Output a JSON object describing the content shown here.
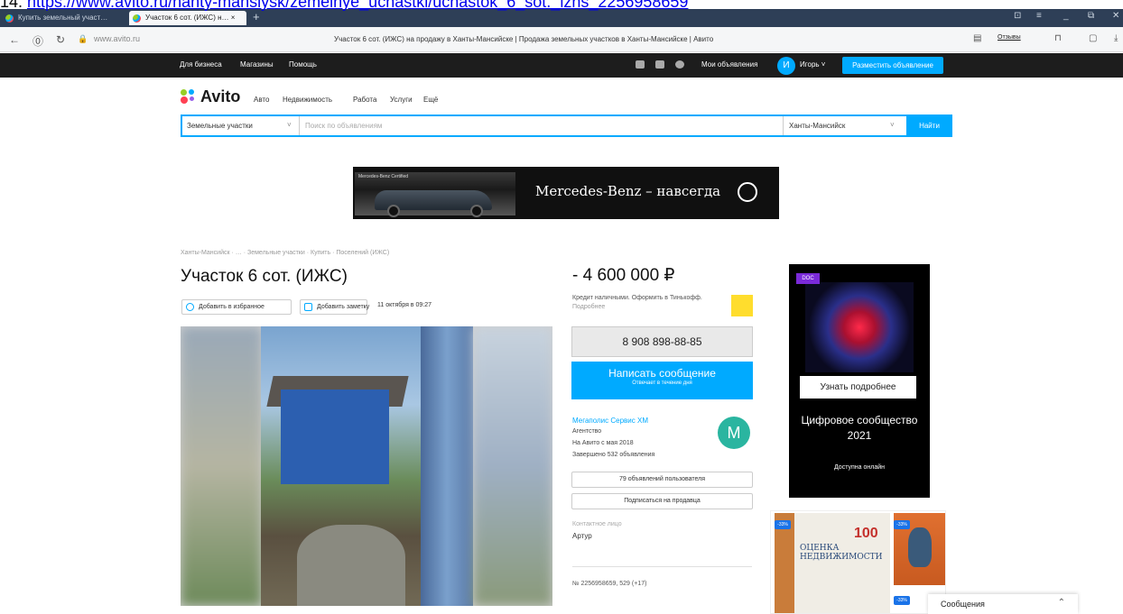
{
  "overlay_url": {
    "prefix": "14. ",
    "link": "https://www.avito.ru/hanty-mansiysk/zemelnye_uchastki/uchastok_6_sot._izhs_2256958659"
  },
  "browser": {
    "tabs": [
      {
        "label": "Купить земельный участ…"
      },
      {
        "label": "Участок 6 сот. (ИЖС) н… ×"
      }
    ],
    "new_tab": "+",
    "address": "www.avito.ru",
    "page_title": "Участок 6 сот. (ИЖС) на продажу в Ханты-Мансийске | Продажа земельных участков в Ханты-Мансийске | Авито",
    "reviews_label": "Отзывы"
  },
  "topnav": {
    "links": [
      "Для бизнеса",
      "Магазины",
      "Помощь"
    ],
    "my_ads": "Мои объявления",
    "avatar_letter": "И",
    "user": "Игорь",
    "post_button": "Разместить объявление"
  },
  "header": {
    "logo": "Avito",
    "categories": [
      "Авто",
      "Недвижимость",
      "Работа",
      "Услуги",
      "Ещё"
    ],
    "category_select": "Земельные участки",
    "search_placeholder": "Поиск по объявлениям",
    "city_select": "Ханты-Мансийск",
    "find_button": "Найти"
  },
  "banner": {
    "small_text": "Mercedes-Benz Certified",
    "text": "Mercedes-Benz – навсегда"
  },
  "listing": {
    "breadcrumb": "Ханты-Мансийск · … · Земельные участки · Купить · Поселений (ИЖС)",
    "title": "Участок 6 сот. (ИЖС)",
    "favorite_label": "Добавить в избранное",
    "note_label": "Добавить заметку",
    "date": "11 октября в 09:27",
    "price": "4 600 000 ₽",
    "credit_text": "Кредит наличными. Оформить в Тинькофф.",
    "credit_more": "Подробнее",
    "phone": "8 908 898-88-85",
    "message_button": "Написать сообщение",
    "message_sub": "Отвечает в течение дня",
    "seller": {
      "name": "Мегаполис Сервис ХМ",
      "type": "Агентство",
      "since": "На Авито с мая 2018",
      "completed": "Завершено 532 объявления",
      "avatar_letter": "M"
    },
    "user_ads_button": "79 объявлений пользователя",
    "subscribe_button": "Подписаться на продавца",
    "contact_label": "Контактное лицо",
    "contact_name": "Артур",
    "item_id": "№ 2256958659, 529 (+17)"
  },
  "ads": {
    "ad1": {
      "logo": "DOC",
      "button": "Узнать подробнее",
      "title": "Цифровое сообщество 2021",
      "subtitle": "Доступна онлайн"
    },
    "ad2": {
      "badge": "-33%",
      "number": "100",
      "book_title": "ОЦЕНКА НЕДВИЖИМОСТИ"
    }
  },
  "messages": {
    "label": "Сообщения",
    "chevron": "⌃"
  }
}
